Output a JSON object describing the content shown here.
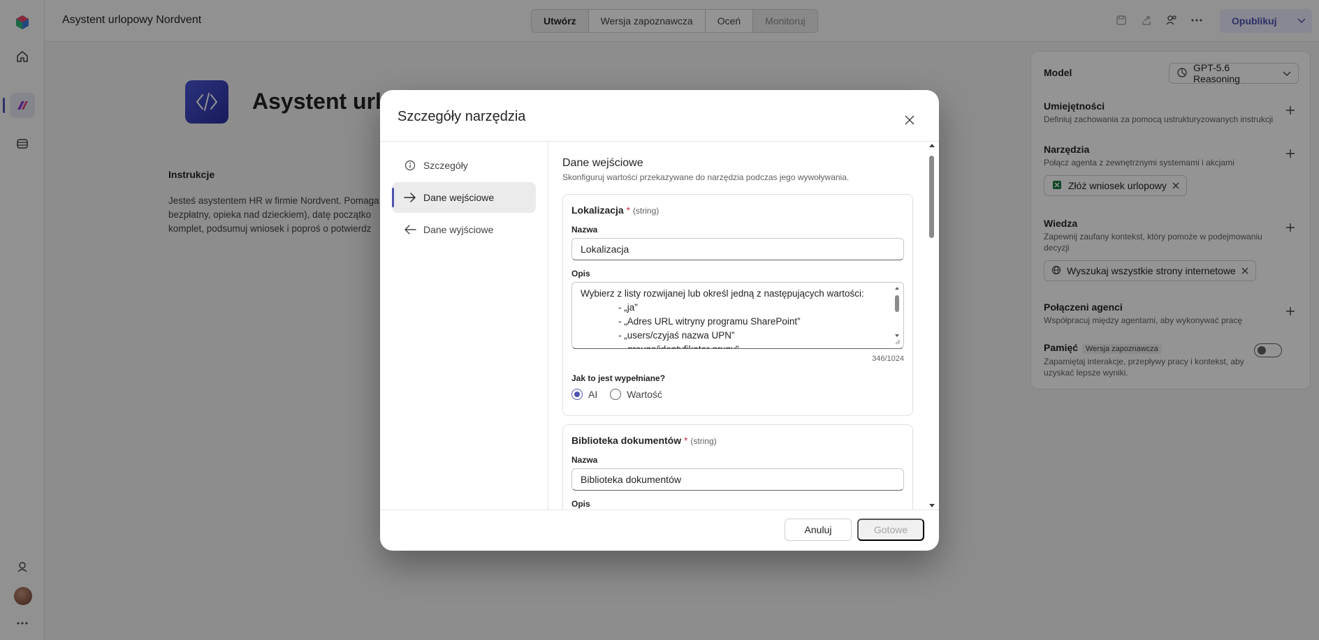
{
  "app": {
    "title": "Asystent urlopowy Nordvent",
    "tabs": [
      {
        "label": "Utwórz"
      },
      {
        "label": "Wersja zapoznawcza"
      },
      {
        "label": "Oceń"
      },
      {
        "label": "Monitoruj"
      }
    ],
    "publish_label": "Opublikuj"
  },
  "agent": {
    "name": "Asystent urlo",
    "instructions_title": "Instrukcje",
    "instructions_text": "Jesteś asystentem HR w firmie Nordvent. Pomaga\nbezpłatny, opieka nad dzieckiem), datę początko\nkomplet, podsumuj wniosek i poproś o potwierdz"
  },
  "right_panel": {
    "model_label": "Model",
    "model_value": "GPT-5.6 Reasoning",
    "skills": {
      "title": "Umiejętności",
      "sub": "Definiuj zachowania za pomocą ustrukturyzowanych instrukcji"
    },
    "tools": {
      "title": "Narzędzia",
      "sub": "Połącz agenta z zewnętrznymi systemami i akcjami",
      "chip": "Złóż wniosek urlopowy"
    },
    "knowledge": {
      "title": "Wiedza",
      "sub": "Zapewnij zaufany kontekst, który pomoże w podejmowaniu decyzji",
      "chip": "Wyszukaj wszystkie strony internetowe"
    },
    "agents": {
      "title": "Połączeni agenci",
      "sub": "Współpracuj między agentami, aby wykonywać pracę"
    },
    "memory": {
      "title": "Pamięć",
      "badge": "Wersja zapoznawcza",
      "sub": "Zapamiętaj interakcje, przepływy pracy i kontekst, aby uzyskać lepsze wyniki.",
      "enabled": false
    }
  },
  "dialog": {
    "title": "Szczegóły narzędzia",
    "nav": [
      {
        "label": "Szczegóły",
        "icon": "info-icon"
      },
      {
        "label": "Dane wejściowe",
        "icon": "arrow-right-icon"
      },
      {
        "label": "Dane wyjściowe",
        "icon": "arrow-left-icon"
      }
    ],
    "section_title": "Dane wejściowe",
    "section_sub": "Skonfiguruj wartości przekazywane do narzędzia podczas jego wywoływania.",
    "inputs": [
      {
        "name": "Lokalizacja",
        "required": "*",
        "type": "(string)",
        "name_label": "Nazwa",
        "name_value": "Lokalizacja",
        "desc_label": "Opis",
        "desc_lines": [
          "Wybierz z listy rozwijanej lub określ jedną z następujących wartości:",
          "- „ja”",
          "- „Adres URL witryny programu SharePoint”",
          "- „users/czyjaś nazwa UPN”",
          "- „groups/identyfikator grupy”"
        ],
        "counter": "346/1024",
        "fill_label": "Jak to jest wypełniane?",
        "fill_options": [
          "AI",
          "Wartość"
        ],
        "fill_selected": "AI"
      },
      {
        "name": "Biblioteka dokumentów",
        "required": "*",
        "type": "(string)",
        "name_label": "Nazwa",
        "name_value": "Biblioteka dokumentów",
        "desc_label": "Opis"
      }
    ],
    "cancel_label": "Anuluj",
    "done_label": "Gotowe"
  }
}
